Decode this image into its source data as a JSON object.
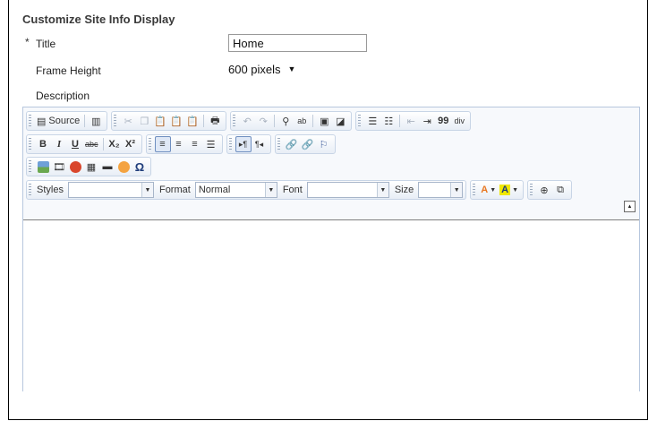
{
  "form": {
    "heading": "Customize Site Info Display",
    "required_mark": "*",
    "title_label": "Title",
    "title_value": "Home",
    "frame_height_label": "Frame Height",
    "frame_height_value": "600 pixels",
    "description_label": "Description"
  },
  "toolbar": {
    "source_label": "Source",
    "bold": "B",
    "italic": "I",
    "underline": "U",
    "strike": "abc",
    "subscript": "X₂",
    "superscript": "X²",
    "blockquote": "99",
    "div": "div",
    "omega": "Ω",
    "styles_label": "Styles",
    "styles_value": "",
    "format_label": "Format",
    "format_value": "Normal",
    "font_label": "Font",
    "font_value": "",
    "size_label": "Size",
    "size_value": "",
    "text_color": "A",
    "bg_color": "A"
  },
  "colors": {
    "text_color_accent": "#e87722",
    "bg_color_accent": "#f0e800"
  }
}
